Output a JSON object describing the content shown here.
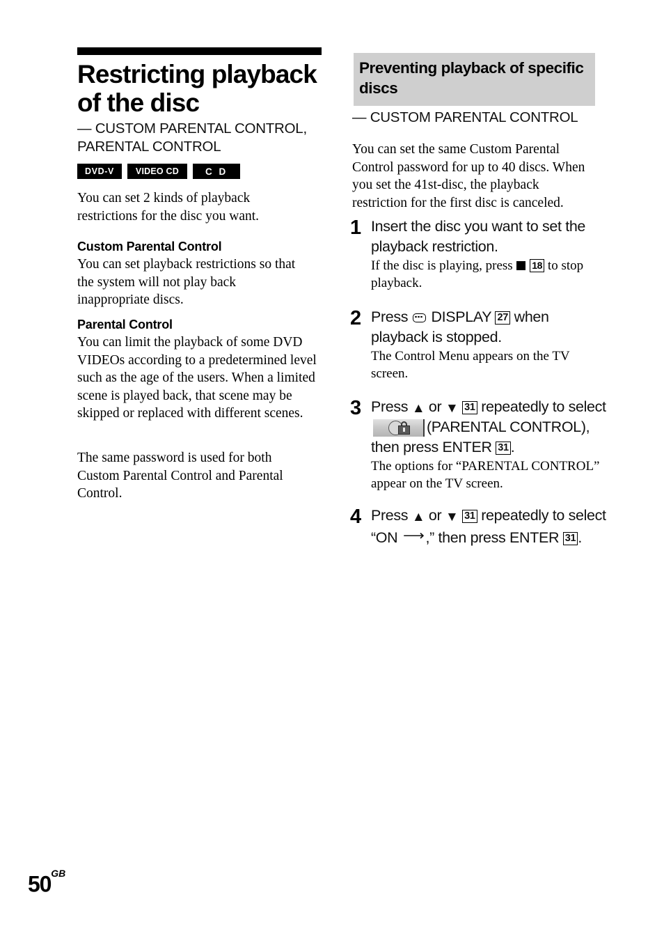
{
  "page": {
    "number": "50",
    "region_suffix": "GB"
  },
  "left_column": {
    "title": "Restricting playback of the disc",
    "subtitle": "— CUSTOM PARENTAL CONTROL, PARENTAL CONTROL",
    "disc_badges": [
      {
        "label": "DVD-V",
        "name": "dvd-v-badge"
      },
      {
        "label": "VIDEO CD",
        "name": "video-cd-badge"
      },
      {
        "label": "C D",
        "name": "cd-badge"
      }
    ],
    "lead_paragraph": "You can set 2 kinds of playback restrictions for the disc you want.",
    "sections": [
      {
        "heading": "Custom Parental Control",
        "body": "You can set playback restrictions so that the system will not play back inappropriate discs."
      },
      {
        "heading": "Parental Control",
        "body": "You can limit the playback of some DVD VIDEOs according to a predetermined level such as the age of the users. When a limited scene is played back, that scene may be skipped or replaced with different scenes."
      }
    ],
    "note": "The same password is used for both Custom Parental Control and Parental Control."
  },
  "right_column": {
    "heading": "Preventing playback of specific discs",
    "subtitle": "— CUSTOM PARENTAL CONTROL",
    "intro": "You can set the same Custom Parental Control password for up to 40 discs. When you set the 41st-disc, the playback restriction for the first disc is canceled.",
    "steps": [
      {
        "number": "1",
        "main_before": "Insert the disc you want to set the playback restriction.",
        "sub_before": "If the disc is playing, press ",
        "sub_ref": "18",
        "sub_after": " to stop playback."
      },
      {
        "number": "2",
        "main_before": "Press ",
        "main_label": " DISPLAY ",
        "main_ref": "27",
        "main_after": " when playback is stopped.",
        "sub": "The Control Menu appears on the TV screen."
      },
      {
        "number": "3",
        "main_press": "Press ",
        "main_arrow_or": " or ",
        "main_ref1": "31",
        "main_repeat": " repeatedly to select ",
        "main_icon_label": "(PARENTAL CONTROL), then press ENTER ",
        "main_ref2": "31",
        "main_period": ".",
        "sub": "The options for “PARENTAL CONTROL” appear on the TV screen."
      },
      {
        "number": "4",
        "main_press": "Press ",
        "main_arrow_or": " or ",
        "main_ref1": "31",
        "main_repeat": " repeatedly to select “ON ",
        "main_after_arrow": ",” then press ENTER ",
        "main_ref2": "31",
        "main_period": "."
      }
    ]
  },
  "icons": {
    "stop": "stop-square-icon",
    "display": "display-icon",
    "arrow_up": "▲",
    "arrow_down": "▼",
    "long_arrow": "⟶",
    "parental_control": "parental-control-lock-icon"
  },
  "colors": {
    "gray_header_bg": "#cfcfcf",
    "text": "#000000",
    "badge_bg": "#000000",
    "badge_text": "#ffffff"
  }
}
